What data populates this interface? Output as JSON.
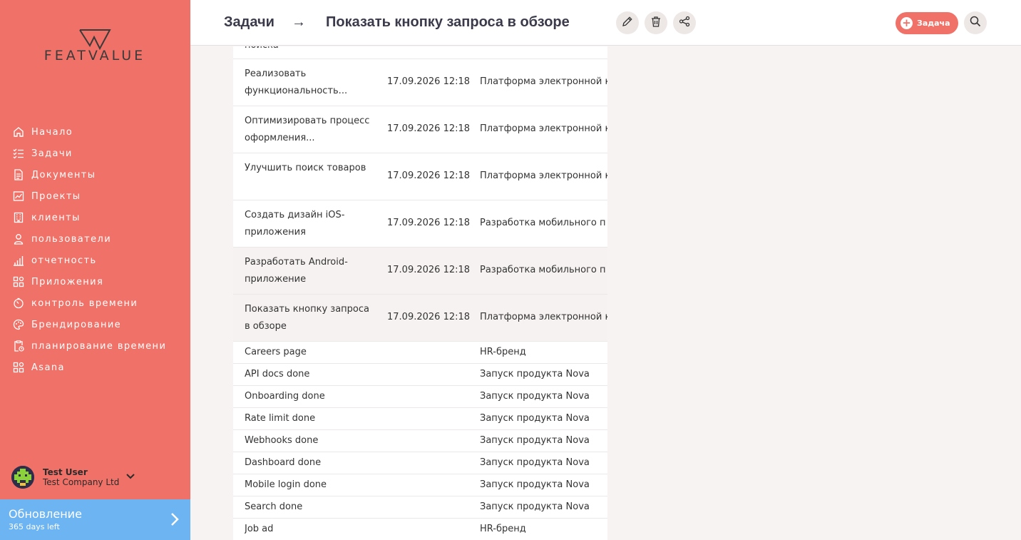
{
  "brand": {
    "name": "FEATVALUE"
  },
  "sidebar": {
    "items": [
      {
        "label": "Начало",
        "icon": "home-icon"
      },
      {
        "label": "Задачи",
        "icon": "tasks-icon"
      },
      {
        "label": "Документы",
        "icon": "document-icon"
      },
      {
        "label": "Проекты",
        "icon": "projects-icon"
      },
      {
        "label": "клиенты",
        "icon": "building-icon"
      },
      {
        "label": "пользователи",
        "icon": "user-icon"
      },
      {
        "label": "отчетность",
        "icon": "chart-icon"
      },
      {
        "label": "Приложения",
        "icon": "apps-icon"
      },
      {
        "label": "контроль времени",
        "icon": "timer-icon"
      },
      {
        "label": "Брендирование",
        "icon": "palette-icon"
      },
      {
        "label": "планирование времени",
        "icon": "clipboard-time-icon"
      },
      {
        "label": "Asana",
        "icon": "apps-icon"
      }
    ],
    "user": {
      "name": "Test User",
      "company": "Test Company Ltd"
    },
    "upgrade": {
      "title": "Обновление",
      "subtitle": "365 days left"
    }
  },
  "header": {
    "root": "Задачи",
    "arrow": "→",
    "title": "Показать кнопку запроса в обзоре",
    "add_label": "Задача"
  },
  "table": {
    "rows": [
      {
        "name": "поиска",
        "date": "",
        "project": ""
      },
      {
        "name": "Реализовать функциональность...",
        "date": "17.09.2026 12:18",
        "project": "Платформа электронной к"
      },
      {
        "name": "Оптимизировать процесс оформления...",
        "date": "17.09.2026 12:18",
        "project": "Платформа электронной к"
      },
      {
        "name": "Улучшить поиск товаров",
        "date": "17.09.2026 12:18",
        "project": "Платформа электронной к"
      },
      {
        "name": "Создать дизайн iOS-приложения",
        "date": "17.09.2026 12:18",
        "project": "Разработка мобильного п"
      },
      {
        "name": "Разработать Android-приложение",
        "date": "17.09.2026 12:18",
        "project": "Разработка мобильного п"
      },
      {
        "name": "Показать кнопку запроса в обзоре",
        "date": "17.09.2026 12:18",
        "project": "Платформа электронной к"
      },
      {
        "name": "Careers page",
        "date": "",
        "project": "HR-бренд"
      },
      {
        "name": "API docs done",
        "date": "",
        "project": "Запуск продукта Nova"
      },
      {
        "name": "Onboarding done",
        "date": "",
        "project": "Запуск продукта Nova"
      },
      {
        "name": "Rate limit done",
        "date": "",
        "project": "Запуск продукта Nova"
      },
      {
        "name": "Webhooks done",
        "date": "",
        "project": "Запуск продукта Nova"
      },
      {
        "name": "Dashboard done",
        "date": "",
        "project": "Запуск продукта Nova"
      },
      {
        "name": "Mobile login done",
        "date": "",
        "project": "Запуск продукта Nova"
      },
      {
        "name": "Search done",
        "date": "",
        "project": "Запуск продукта Nova"
      },
      {
        "name": "Job ad",
        "date": "",
        "project": "HR-бренд"
      }
    ]
  },
  "colors": {
    "accent": "#f07167",
    "upgrade": "#6cb4f2"
  }
}
